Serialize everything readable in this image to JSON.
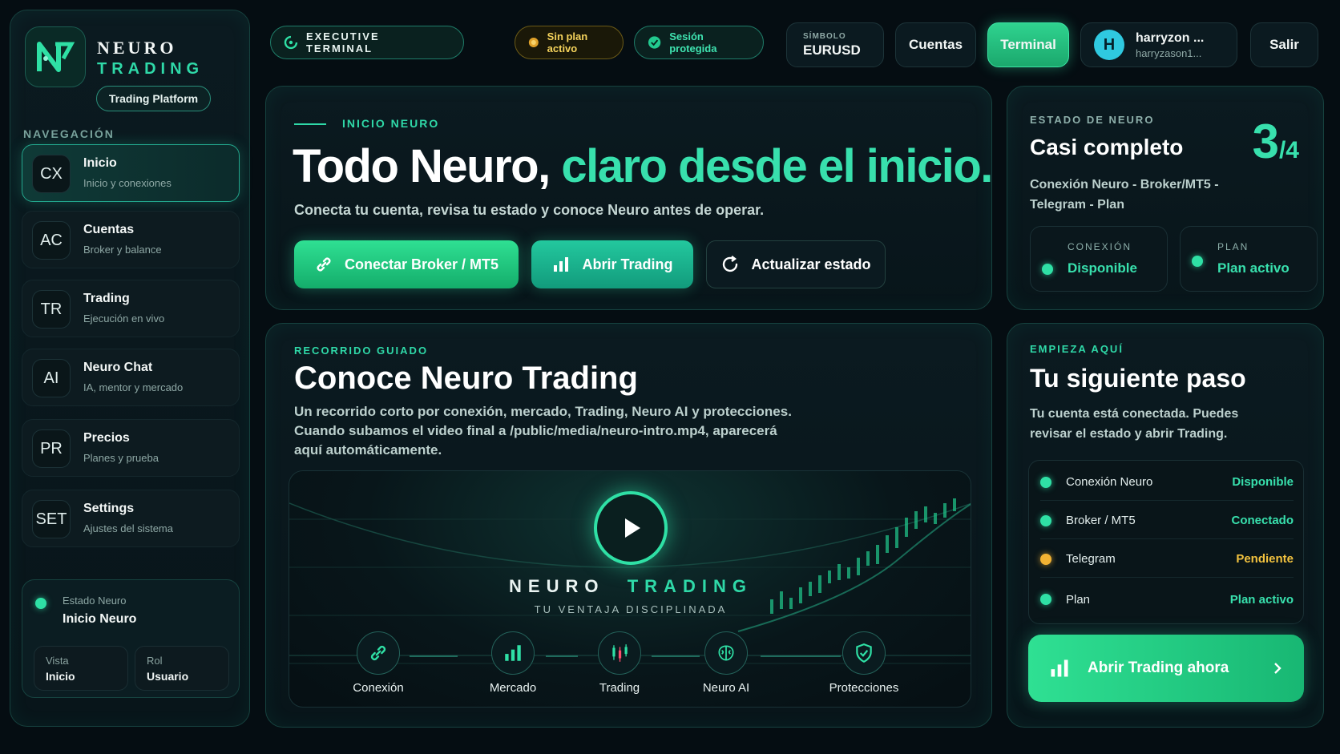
{
  "brand": {
    "line1": "NEURO",
    "line2": "TRADING",
    "pill": "Trading Platform"
  },
  "sidebar": {
    "title": "NAVEGACIÓN",
    "items": [
      {
        "abbr": "CX",
        "label": "Inicio",
        "sub": "Inicio y conexiones",
        "active": true
      },
      {
        "abbr": "AC",
        "label": "Cuentas",
        "sub": "Broker y balance"
      },
      {
        "abbr": "TR",
        "label": "Trading",
        "sub": "Ejecución en vivo"
      },
      {
        "abbr": "AI",
        "label": "Neuro Chat",
        "sub": "IA, mentor y mercado"
      },
      {
        "abbr": "PR",
        "label": "Precios",
        "sub": "Planes y prueba"
      },
      {
        "abbr": "SET",
        "label": "Settings",
        "sub": "Ajustes del sistema"
      }
    ],
    "status": {
      "label": "Estado Neuro",
      "value": "Inicio Neuro",
      "vista_label": "Vista",
      "vista_value": "Inicio",
      "rol_label": "Rol",
      "rol_value": "Usuario"
    }
  },
  "topbar": {
    "executive": "EXECUTIVE TERMINAL",
    "plan_badge": "Sin plan activo",
    "session_badge": "Sesión protegida",
    "symbol_label": "SÍMBOLO",
    "symbol_value": "EURUSD",
    "cuentas": "Cuentas",
    "terminal": "Terminal",
    "user_initial": "H",
    "user_name": "harryzon ...",
    "user_email": "harryzason1...",
    "salir": "Salir"
  },
  "hero": {
    "eyebrow": "INICIO NEURO",
    "title_white": "Todo Neuro, ",
    "title_green": "claro desde el inicio.",
    "subtitle": "Conecta tu cuenta, revisa tu estado y conoce Neuro antes de operar.",
    "btn_connect": "Conectar Broker / MT5",
    "btn_trading": "Abrir Trading",
    "btn_refresh": "Actualizar estado"
  },
  "estado": {
    "eyebrow": "ESTADO DE NEURO",
    "title": "Casi completo",
    "score_num": "3",
    "score_den": "/4",
    "desc_line1": "Conexión Neuro - Broker/MT5 -",
    "desc_line2": "Telegram - Plan",
    "conexion_label": "CONEXIÓN",
    "conexion_value": "Disponible",
    "plan_label": "PLAN",
    "plan_value": "Plan activo"
  },
  "tour": {
    "eyebrow": "RECORRIDO GUIADO",
    "title": "Conoce Neuro Trading",
    "line1": "Un recorrido corto por conexión, mercado, Trading, Neuro AI y protecciones.",
    "line2": "Cuando subamos el video final a /public/media/neuro-intro.mp4, aparecerá",
    "line3": "aquí automáticamente.",
    "video_brand1": "NEURO",
    "video_brand2": "TRADING",
    "video_tagline": "TU VENTAJA DISCIPLINADA",
    "steps": [
      "Conexión",
      "Mercado",
      "Trading",
      "Neuro AI",
      "Protecciones"
    ]
  },
  "next": {
    "eyebrow": "EMPIEZA AQUÍ",
    "title": "Tu siguiente paso",
    "desc_line1": "Tu cuenta está conectada. Puedes",
    "desc_line2": "revisar el estado y abrir Trading.",
    "checks": [
      {
        "label": "Conexión Neuro",
        "value": "Disponible",
        "color": "#2fe0a5"
      },
      {
        "label": "Broker / MT5",
        "value": "Conectado",
        "color": "#2fe0a5"
      },
      {
        "label": "Telegram",
        "value": "Pendiente",
        "color": "#f2b233"
      },
      {
        "label": "Plan",
        "value": "Plan activo",
        "color": "#2fe0a5"
      }
    ],
    "cta": "Abrir Trading ahora"
  },
  "colors": {
    "accent": "#2fd9a8",
    "warning": "#f2b233",
    "background": "#050d12"
  }
}
